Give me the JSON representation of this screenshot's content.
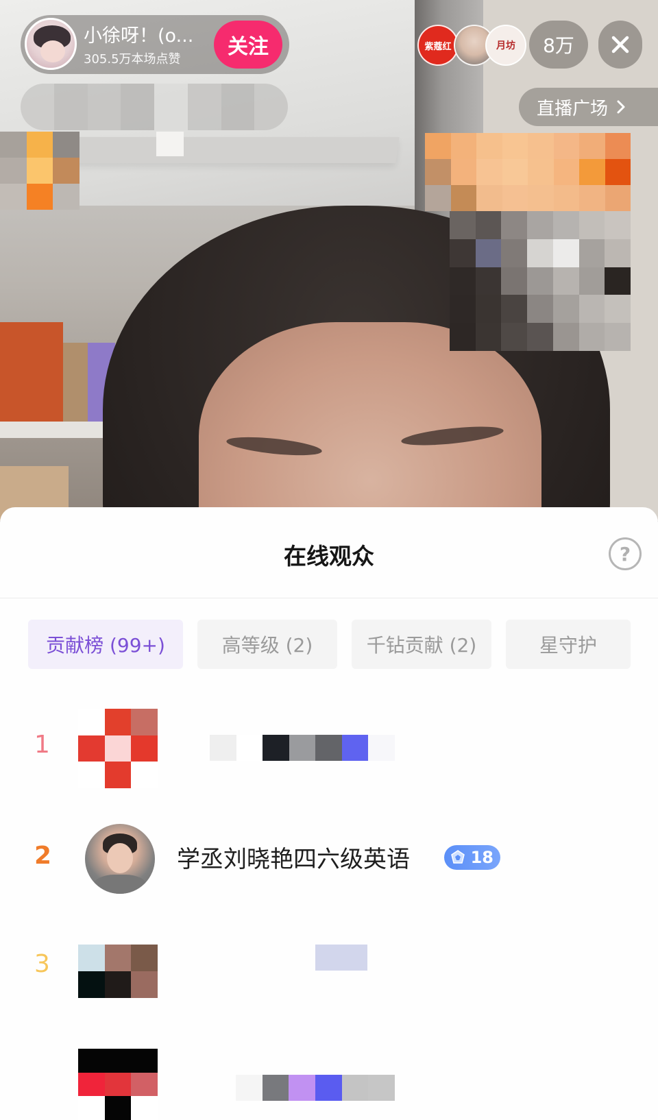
{
  "header": {
    "host_name": "小徐呀！(o...",
    "host_likes": "305.5万本场点赞",
    "follow_label": "关注",
    "top_ranks": [
      {
        "label": "紫蔻红"
      },
      {
        "label": ""
      },
      {
        "label": "月坊"
      }
    ],
    "viewer_count": "8万",
    "live_square_label": "直播广场"
  },
  "sheet": {
    "title": "在线观众",
    "tabs": [
      {
        "label": "贡献榜 (99+)",
        "active": true
      },
      {
        "label": "高等级 (2)",
        "active": false
      },
      {
        "label": "千钻贡献 (2)",
        "active": false
      },
      {
        "label": "星守护",
        "active": false
      }
    ],
    "ranking": [
      {
        "rank": "1",
        "name": ""
      },
      {
        "rank": "2",
        "name": "学丞刘晓艳四六级英语",
        "level": "18"
      },
      {
        "rank": "3",
        "name": ""
      },
      {
        "rank": "",
        "name": ""
      }
    ]
  },
  "colors": {
    "follow": "#f62b6e",
    "tab_active_text": "#7b4fd6",
    "tab_active_bg": "#f3effb",
    "level_badge": "#5b8ff8",
    "rank1": "#f07a86",
    "rank2": "#f07c2a",
    "rank3": "#f7c65a"
  },
  "icons": {
    "close": "close-icon",
    "chevron": "chevron-right-icon",
    "help": "help-icon",
    "level": "level-gem-icon"
  }
}
